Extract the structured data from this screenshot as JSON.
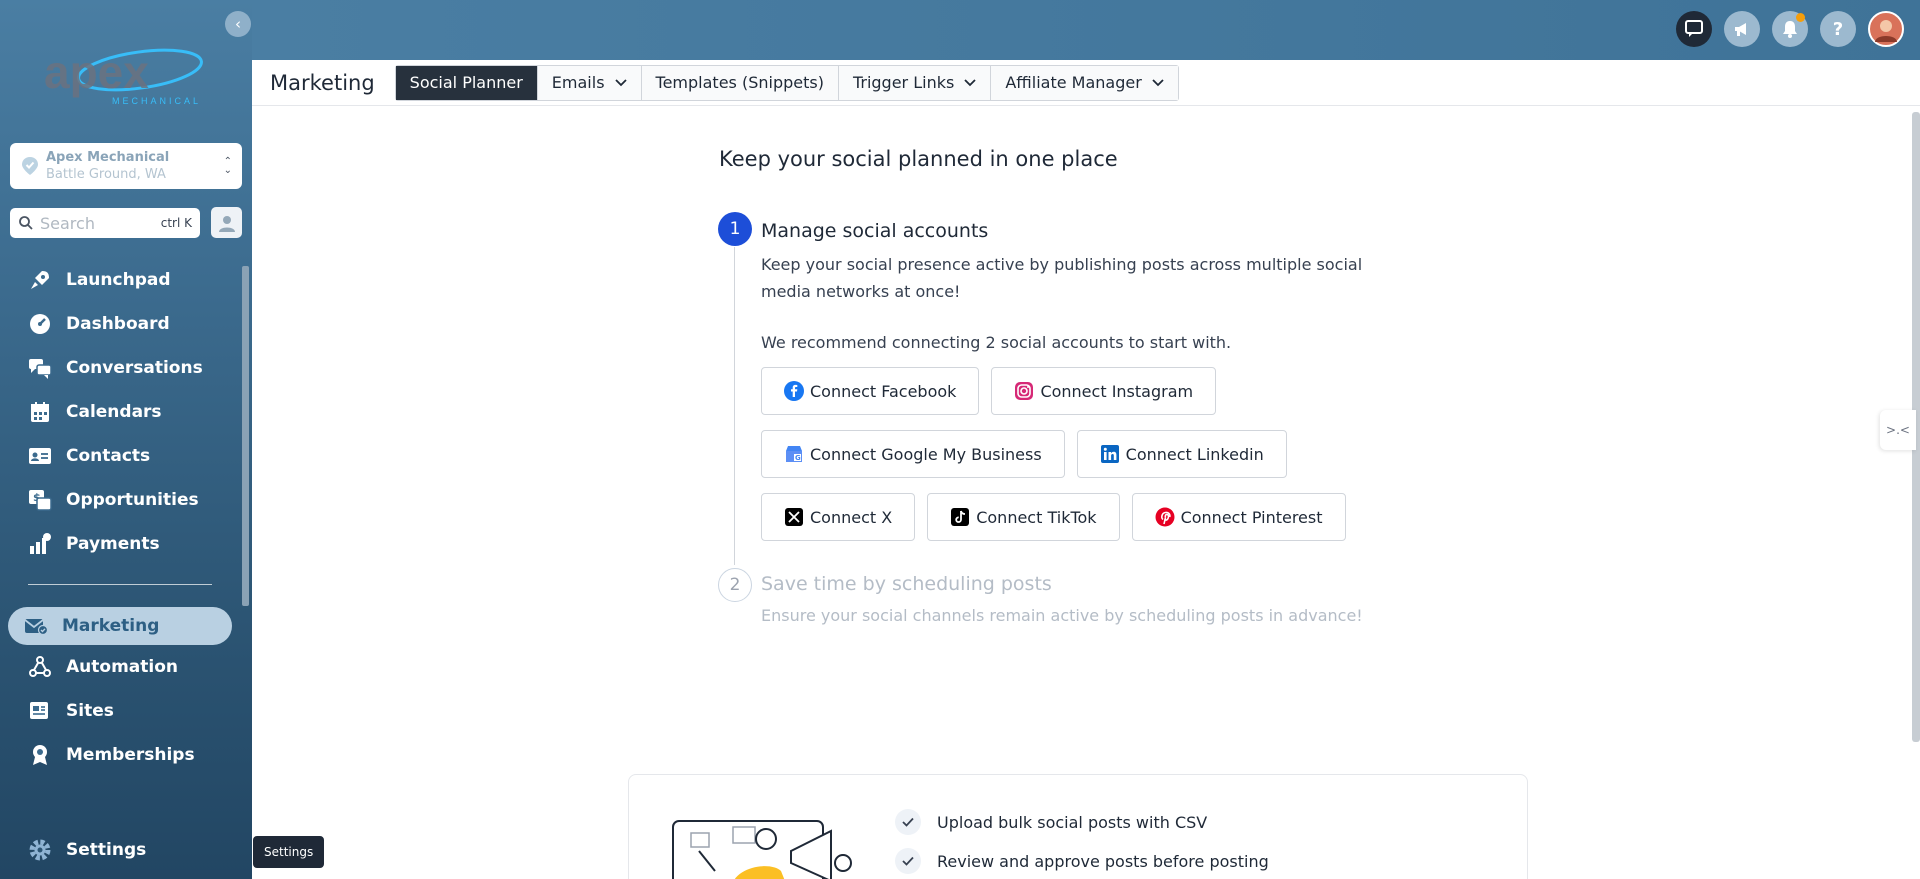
{
  "sidebar": {
    "location": {
      "name": "Apex Mechanical",
      "city": "Battle Ground, WA"
    },
    "search": {
      "placeholder": "Search",
      "shortcut": "ctrl K"
    },
    "items": [
      {
        "label": "Launchpad",
        "icon": "rocket-icon"
      },
      {
        "label": "Dashboard",
        "icon": "gauge-icon"
      },
      {
        "label": "Conversations",
        "icon": "chat-bubbles-icon"
      },
      {
        "label": "Calendars",
        "icon": "calendar-icon"
      },
      {
        "label": "Contacts",
        "icon": "contact-card-icon"
      },
      {
        "label": "Opportunities",
        "icon": "opportunity-icon"
      },
      {
        "label": "Payments",
        "icon": "payments-icon"
      }
    ],
    "items2": [
      {
        "label": "Marketing",
        "icon": "marketing-mail-icon",
        "active": true
      },
      {
        "label": "Automation",
        "icon": "automation-icon"
      },
      {
        "label": "Sites",
        "icon": "sites-icon"
      },
      {
        "label": "Memberships",
        "icon": "membership-badge-icon"
      }
    ],
    "settings": {
      "label": "Settings",
      "tooltip": "Settings"
    }
  },
  "header": {
    "module_title": "Marketing",
    "tabs": [
      {
        "label": "Social Planner",
        "active": true,
        "dropdown": false
      },
      {
        "label": "Emails",
        "dropdown": true
      },
      {
        "label": "Templates (Snippets)",
        "dropdown": false
      },
      {
        "label": "Trigger Links",
        "dropdown": true
      },
      {
        "label": "Affiliate Manager",
        "dropdown": true
      }
    ]
  },
  "main": {
    "heading": "Keep your social planned in one place",
    "step1": {
      "number": "1",
      "title": "Manage social accounts",
      "description": "Keep your social presence active by publishing posts across multiple social media networks at once!",
      "recommend": "We recommend connecting 2 social accounts to start with."
    },
    "connect_buttons": [
      {
        "prefix": "Connect",
        "network": "Facebook",
        "icon": "facebook-icon",
        "color": "#1877f2"
      },
      {
        "prefix": "Connect",
        "network": "Instagram",
        "icon": "instagram-icon",
        "color": "#d62976"
      },
      {
        "prefix": "Connect",
        "network": "Google My Business",
        "icon": "google-my-business-icon",
        "color": "#4285f4"
      },
      {
        "prefix": "Connect",
        "network": "Linkedin",
        "icon": "linkedin-icon",
        "color": "#0a66c2"
      },
      {
        "prefix": "Connect",
        "network": "X",
        "icon": "x-icon",
        "color": "#000000"
      },
      {
        "prefix": "Connect",
        "network": "TikTok",
        "icon": "tiktok-icon",
        "color": "#000000"
      },
      {
        "prefix": "Connect",
        "network": "Pinterest",
        "icon": "pinterest-icon",
        "color": "#e60023"
      }
    ],
    "step2": {
      "number": "2",
      "title": "Save time by scheduling posts",
      "description": "Ensure your social channels remain active by scheduling posts in advance!"
    },
    "features": [
      "Upload bulk social posts with CSV",
      "Review and approve posts before posting"
    ]
  },
  "colors": {
    "sidebar_top": "#4a7ea3",
    "sidebar_bottom": "#224663",
    "active_tab": "#27313d",
    "step_active": "#1d4ed8",
    "marketing_active_bg": "#b9d0e2"
  }
}
